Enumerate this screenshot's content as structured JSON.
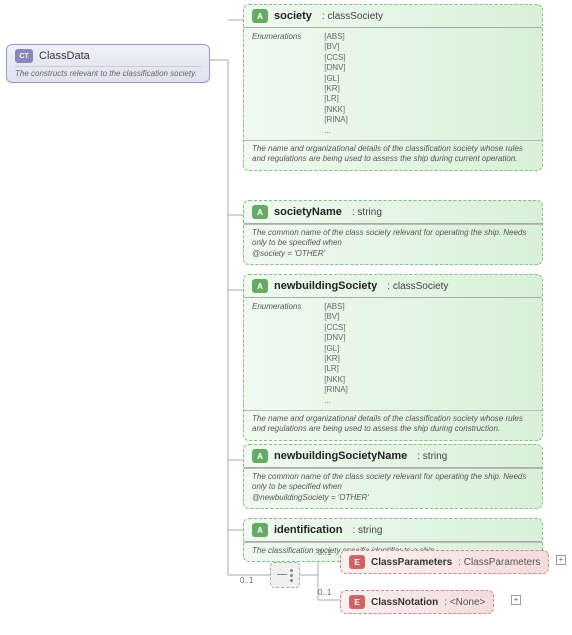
{
  "root": {
    "badge": "CT",
    "name": "ClassData",
    "description": "The constructs relevant to the classification society."
  },
  "attributes": [
    {
      "badge": "A",
      "name": "society",
      "type": ": classSociety",
      "enum_label": "Enumerations",
      "enums": [
        "[ABS]",
        "[BV]",
        "[CCS]",
        "[DNV]",
        "[GL]",
        "[KR]",
        "[LR]",
        "[NKK]",
        "[RINA]",
        "..."
      ],
      "desc": "The name and organizational details of the classification society whose rules and regulations are being used to assess the ship during current operation."
    },
    {
      "badge": "A",
      "name": "societyName",
      "type": ": string",
      "desc": "The common name of the class society relevant for operating the ship. Needs only to be specified when\n@society = 'OTHER'"
    },
    {
      "badge": "A",
      "name": "newbuildingSociety",
      "type": ": classSociety",
      "enum_label": "Enumerations",
      "enums": [
        "[ABS]",
        "[BV]",
        "[CCS]",
        "[DNV]",
        "[GL]",
        "[KR]",
        "[LR]",
        "[NKK]",
        "[RINA]",
        "..."
      ],
      "desc": "The name and organizational details of the classification society whose rules and regulations are being used to assess the ship during construction."
    },
    {
      "badge": "A",
      "name": "newbuildingSocietyName",
      "type": ": string",
      "desc": "The common name of the class society relevant for operating the ship. Needs only to be specified when\n@newbuildingSociety = 'OTHER'"
    },
    {
      "badge": "A",
      "name": "identification",
      "type": ": string",
      "desc": "The classification society specific identifier to a ship."
    }
  ],
  "cardinality": {
    "root_seq": "0..1",
    "seq_cp": "0..1",
    "seq_cn": "0..1"
  },
  "elements": [
    {
      "badge": "E",
      "name": "ClassParameters",
      "type": ": ClassParameters"
    },
    {
      "badge": "E",
      "name": "ClassNotation",
      "type": ": <None>"
    }
  ],
  "expander": "+"
}
